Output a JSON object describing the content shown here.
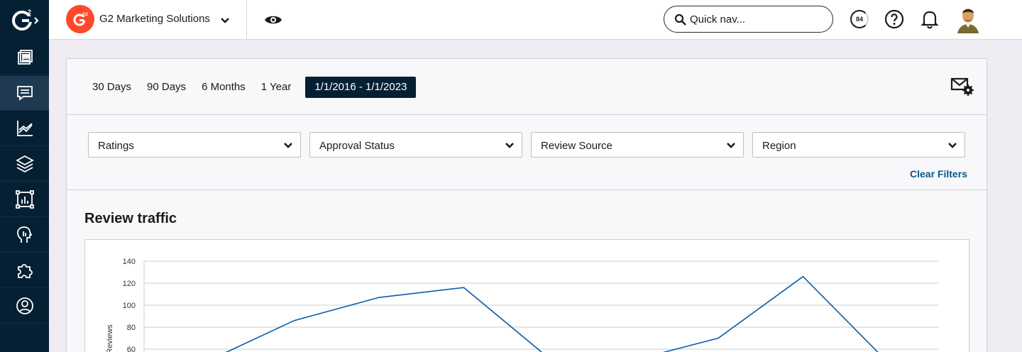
{
  "org": {
    "name": "G2 Marketing Solutions",
    "logo_text": "G2"
  },
  "search": {
    "placeholder": "Quick nav..."
  },
  "topbar": {
    "score": "84"
  },
  "sidebar": {
    "items": [
      {
        "icon": "dashboard-icon"
      },
      {
        "icon": "reviews-icon",
        "active": true
      },
      {
        "icon": "analytics-chart-icon"
      },
      {
        "icon": "layers-icon"
      },
      {
        "icon": "report-frame-icon"
      },
      {
        "icon": "head-profile-icon"
      },
      {
        "icon": "puzzle-icon"
      },
      {
        "icon": "account-icon"
      }
    ]
  },
  "date_range": {
    "tabs": [
      "30 Days",
      "90 Days",
      "6 Months",
      "1 Year"
    ],
    "selected": "1/1/2016 - 1/1/2023"
  },
  "filters": {
    "items": [
      "Ratings",
      "Approval Status",
      "Review Source",
      "Region"
    ],
    "clear_label": "Clear Filters"
  },
  "section": {
    "title": "Review traffic"
  },
  "colors": {
    "accent": "#062033",
    "line": "#0b5ca8",
    "link": "#0b5a8c",
    "brand": "#ff492c"
  },
  "chart_data": {
    "type": "line",
    "title": "",
    "xlabel": "",
    "ylabel": "Reviews",
    "ylim": [
      0,
      140
    ],
    "yticks": [
      60,
      80,
      100,
      120,
      140
    ],
    "grid": true,
    "series": [
      {
        "values": [
          50,
          86,
          107,
          116,
          52,
          50,
          70,
          126,
          48
        ]
      }
    ]
  }
}
